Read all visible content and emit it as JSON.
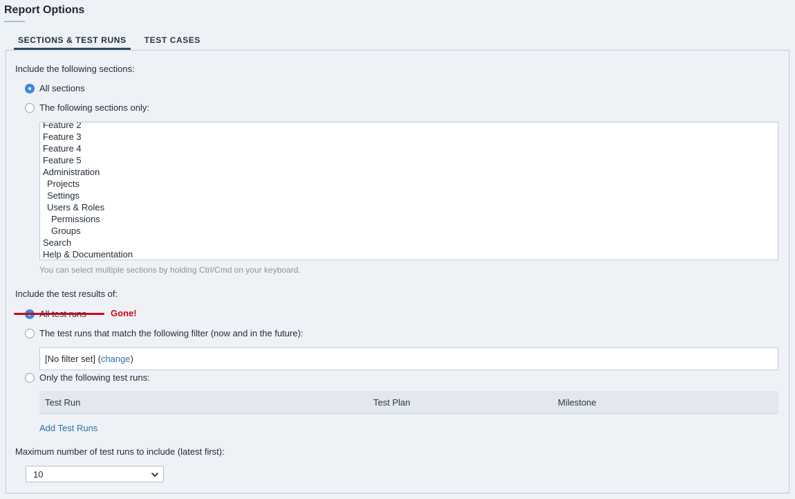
{
  "page": {
    "title": "Report Options"
  },
  "tabs": [
    {
      "label": "SECTIONS & TEST RUNS",
      "active": true
    },
    {
      "label": "TEST CASES",
      "active": false
    }
  ],
  "sections": {
    "label": "Include the following sections:",
    "options": [
      {
        "label": "All sections",
        "checked": true
      },
      {
        "label": "The following sections only:",
        "checked": false
      }
    ],
    "items": [
      {
        "label": "Feature 2",
        "indent": 0
      },
      {
        "label": "Feature 3",
        "indent": 0
      },
      {
        "label": "Feature 4",
        "indent": 0
      },
      {
        "label": "Feature 5",
        "indent": 0
      },
      {
        "label": "Administration",
        "indent": 0
      },
      {
        "label": "Projects",
        "indent": 1
      },
      {
        "label": "Settings",
        "indent": 1
      },
      {
        "label": "Users & Roles",
        "indent": 1
      },
      {
        "label": "Permissions",
        "indent": 2
      },
      {
        "label": "Groups",
        "indent": 2
      },
      {
        "label": "Search",
        "indent": 0
      },
      {
        "label": "Help & Documentation",
        "indent": 0
      }
    ],
    "hint": "You can select multiple sections by holding Ctrl/Cmd on your keyboard."
  },
  "results": {
    "label": "Include the test results of:",
    "options": [
      {
        "label": "All test runs",
        "checked": true
      },
      {
        "label": "The test runs that match the following filter (now and in the future):",
        "checked": false
      },
      {
        "label": "Only the following test runs:",
        "checked": false
      }
    ],
    "annotation": "Gone!",
    "filter": {
      "text": "[No filter set] (",
      "link": "change",
      "close": ")"
    },
    "table_headers": [
      "Test Run",
      "Test Plan",
      "Milestone"
    ],
    "add_runs": "Add Test Runs"
  },
  "max_runs": {
    "label": "Maximum number of test runs to include (latest first):",
    "selected": "10"
  },
  "colors": {
    "accent": "#3d8ae0",
    "annotation": "#d0021b",
    "link": "#2d6fa8"
  }
}
